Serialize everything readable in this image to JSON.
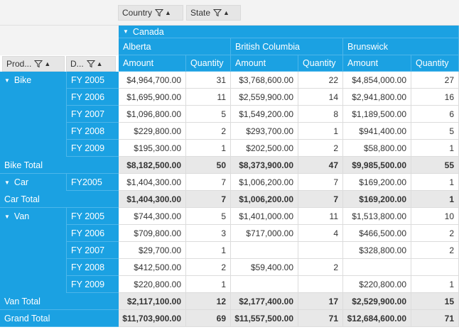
{
  "filters": {
    "columns": [
      {
        "label": "Country"
      },
      {
        "label": "State"
      }
    ],
    "rows": [
      {
        "label": "Prod..."
      },
      {
        "label": "D..."
      }
    ]
  },
  "columns": {
    "country": "Canada",
    "states": [
      "Alberta",
      "British Columbia",
      "Brunswick"
    ],
    "measures": [
      "Amount",
      "Quantity"
    ]
  },
  "rows": [
    {
      "product": "Bike",
      "expand": true,
      "year": "FY 2005",
      "values": [
        "$4,964,700.00",
        "31",
        "$3,768,600.00",
        "22",
        "$4,854,000.00",
        "27"
      ]
    },
    {
      "product": "",
      "year": "FY 2006",
      "values": [
        "$1,695,900.00",
        "11",
        "$2,559,900.00",
        "14",
        "$2,941,800.00",
        "16"
      ]
    },
    {
      "product": "",
      "year": "FY 2007",
      "values": [
        "$1,096,800.00",
        "5",
        "$1,549,200.00",
        "8",
        "$1,189,500.00",
        "6"
      ]
    },
    {
      "product": "",
      "year": "FY 2008",
      "values": [
        "$229,800.00",
        "2",
        "$293,700.00",
        "1",
        "$941,400.00",
        "5"
      ]
    },
    {
      "product": "",
      "year": "FY 2009",
      "values": [
        "$195,300.00",
        "1",
        "$202,500.00",
        "2",
        "$58,800.00",
        "1"
      ]
    },
    {
      "product": "Bike Total",
      "total": true,
      "values": [
        "$8,182,500.00",
        "50",
        "$8,373,900.00",
        "47",
        "$9,985,500.00",
        "55"
      ]
    },
    {
      "product": "Car",
      "expand": true,
      "year": "FY2005",
      "values": [
        "$1,404,300.00",
        "7",
        "$1,006,200.00",
        "7",
        "$169,200.00",
        "1"
      ]
    },
    {
      "product": "Car Total",
      "total": true,
      "values": [
        "$1,404,300.00",
        "7",
        "$1,006,200.00",
        "7",
        "$169,200.00",
        "1"
      ]
    },
    {
      "product": "Van",
      "expand": true,
      "year": "FY 2005",
      "values": [
        "$744,300.00",
        "5",
        "$1,401,000.00",
        "11",
        "$1,513,800.00",
        "10"
      ]
    },
    {
      "product": "",
      "year": "FY 2006",
      "values": [
        "$709,800.00",
        "3",
        "$717,000.00",
        "4",
        "$466,500.00",
        "2"
      ]
    },
    {
      "product": "",
      "year": "FY 2007",
      "values": [
        "$29,700.00",
        "1",
        "",
        "",
        "$328,800.00",
        "2"
      ]
    },
    {
      "product": "",
      "year": "FY 2008",
      "values": [
        "$412,500.00",
        "2",
        "$59,400.00",
        "2",
        "",
        ""
      ]
    },
    {
      "product": "",
      "year": "FY 2009",
      "values": [
        "$220,800.00",
        "1",
        "",
        "",
        "$220,800.00",
        "1"
      ]
    },
    {
      "product": "Van Total",
      "total": true,
      "values": [
        "$2,117,100.00",
        "12",
        "$2,177,400.00",
        "17",
        "$2,529,900.00",
        "15"
      ]
    },
    {
      "product": "Grand Total",
      "total": true,
      "values": [
        "$11,703,900.00",
        "69",
        "$11,557,500.00",
        "71",
        "$12,684,600.00",
        "71"
      ]
    }
  ]
}
